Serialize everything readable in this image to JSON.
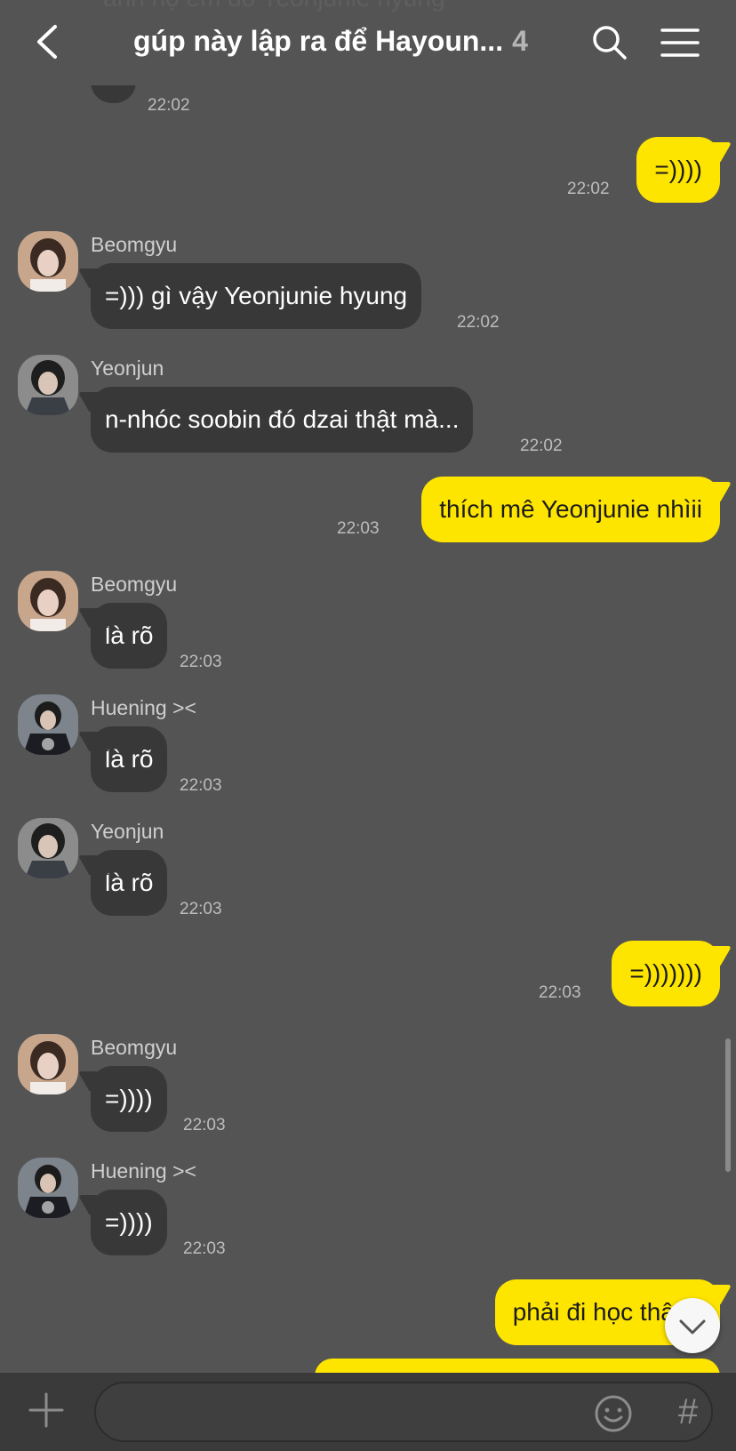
{
  "header": {
    "ghost_text": "anh họ em đó Yeonjunie hyung",
    "title": "gúp này lập ra để Hayoun...",
    "member_count": "4",
    "icons": {
      "back": "chevron-left-icon",
      "search": "search-icon",
      "menu": "hamburger-menu-icon"
    }
  },
  "messages": [
    {
      "type": "in",
      "sender": "",
      "text": "...",
      "time": "22:02"
    },
    {
      "type": "out",
      "text": "=))))",
      "time": "22:02"
    },
    {
      "type": "in",
      "sender": "Beomgyu",
      "text": "=))) gì vậy Yeonjunie hyung",
      "time": "22:02"
    },
    {
      "type": "in",
      "sender": "Yeonjun",
      "text": "n-nhóc soobin đó dzai thật mà...",
      "time": "22:02"
    },
    {
      "type": "out",
      "text": "thích mê Yeonjunie nhìii",
      "time": "22:03"
    },
    {
      "type": "in",
      "sender": "Beomgyu",
      "text": "là rõ",
      "time": "22:03"
    },
    {
      "type": "in",
      "sender": "Huening ><",
      "text": "là rõ",
      "time": "22:03"
    },
    {
      "type": "in",
      "sender": "Yeonjun",
      "text": "là rõ",
      "time": "22:03"
    },
    {
      "type": "out",
      "text": "=)))))))",
      "time": "22:03"
    },
    {
      "type": "in",
      "sender": "Beomgyu",
      "text": "=))))",
      "time": "22:03"
    },
    {
      "type": "in",
      "sender": "Huening ><",
      "text": "=))))",
      "time": "22:03"
    },
    {
      "type": "out",
      "text": "phải đi học thật à",
      "time": ""
    }
  ],
  "input": {
    "placeholder": "",
    "value": ""
  },
  "bottom": {
    "icons": {
      "add": "plus-icon",
      "emoji": "emoji-icon",
      "hashtag": "hashtag-icon"
    },
    "hash_label": "#"
  },
  "colors": {
    "background": "#545454",
    "incoming_bubble": "#383838",
    "outgoing_bubble": "#fee500",
    "bottom_bar": "#3a3a3a"
  }
}
